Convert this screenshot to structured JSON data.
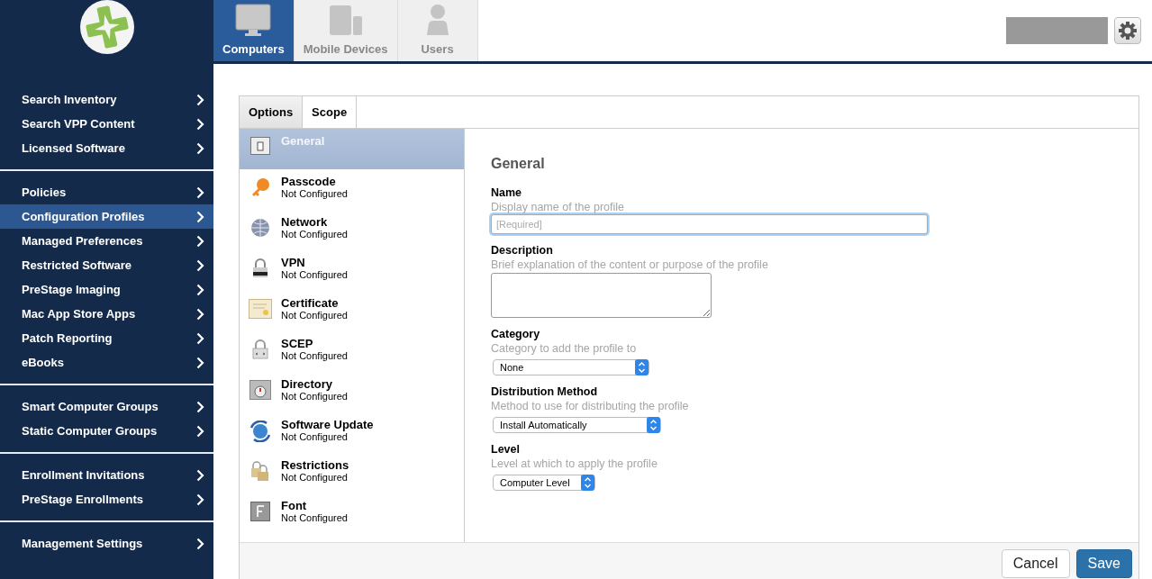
{
  "sidebar": {
    "groups": [
      {
        "items": [
          {
            "label": "Search Inventory",
            "selected": false
          },
          {
            "label": "Search VPP Content",
            "selected": false
          },
          {
            "label": "Licensed Software",
            "selected": false
          }
        ]
      },
      {
        "items": [
          {
            "label": "Policies",
            "selected": false
          },
          {
            "label": "Configuration Profiles",
            "selected": true
          },
          {
            "label": "Managed Preferences",
            "selected": false
          },
          {
            "label": "Restricted Software",
            "selected": false
          },
          {
            "label": "PreStage Imaging",
            "selected": false
          },
          {
            "label": "Mac App Store Apps",
            "selected": false
          },
          {
            "label": "Patch Reporting",
            "selected": false
          },
          {
            "label": "eBooks",
            "selected": false
          }
        ]
      },
      {
        "items": [
          {
            "label": "Smart Computer Groups",
            "selected": false
          },
          {
            "label": "Static Computer Groups",
            "selected": false
          }
        ]
      },
      {
        "items": [
          {
            "label": "Enrollment Invitations",
            "selected": false
          },
          {
            "label": "PreStage Enrollments",
            "selected": false
          }
        ]
      },
      {
        "items": [
          {
            "label": "Management Settings",
            "selected": false
          }
        ]
      }
    ]
  },
  "header": {
    "tabs": [
      {
        "label": "Computers",
        "selected": true
      },
      {
        "label": "Mobile Devices",
        "selected": false
      },
      {
        "label": "Users",
        "selected": false
      }
    ]
  },
  "editor": {
    "tabs": [
      {
        "label": "Options",
        "selected": true
      },
      {
        "label": "Scope",
        "selected": false
      }
    ],
    "payloads": [
      {
        "name": "General",
        "selected": true
      },
      {
        "name": "Passcode",
        "status": "Not Configured",
        "selected": false
      },
      {
        "name": "Network",
        "status": "Not Configured",
        "selected": false
      },
      {
        "name": "VPN",
        "status": "Not Configured",
        "selected": false
      },
      {
        "name": "Certificate",
        "status": "Not Configured",
        "selected": false
      },
      {
        "name": "SCEP",
        "status": "Not Configured",
        "selected": false
      },
      {
        "name": "Directory",
        "status": "Not Configured",
        "selected": false
      },
      {
        "name": "Software Update",
        "status": "Not Configured",
        "selected": false
      },
      {
        "name": "Restrictions",
        "status": "Not Configured",
        "selected": false
      },
      {
        "name": "Font",
        "status": "Not Configured",
        "selected": false
      }
    ],
    "section_title": "General",
    "fields": [
      {
        "kind": "text",
        "label": "Name",
        "hint": "Display name of the profile",
        "placeholder": "[Required]",
        "focused": true
      },
      {
        "kind": "textarea",
        "label": "Description",
        "hint": "Brief explanation of the content or purpose of the profile"
      },
      {
        "kind": "select",
        "label": "Category",
        "hint": "Category to add the profile to",
        "value": "None"
      },
      {
        "kind": "select",
        "label": "Distribution Method",
        "hint": "Method to use for distributing the profile",
        "value": "Install Automatically"
      },
      {
        "kind": "select",
        "label": "Level",
        "hint": "Level at which to apply the profile",
        "value": "Computer Level"
      }
    ],
    "buttons": [
      {
        "label": "Cancel",
        "kind": "secondary"
      },
      {
        "label": "Save",
        "kind": "primary"
      }
    ]
  }
}
